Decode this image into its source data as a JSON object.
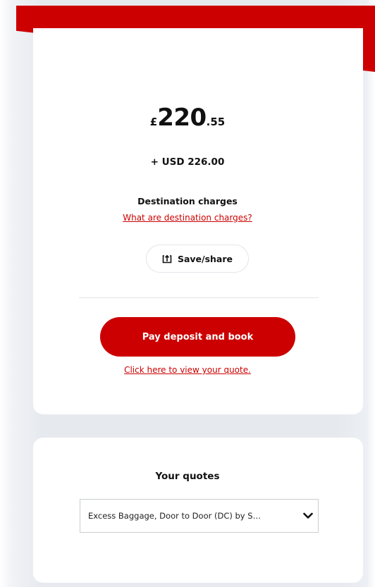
{
  "price": {
    "currency_symbol": "£",
    "whole": "220",
    "decimal": ".55",
    "additional": "+ USD 226.00"
  },
  "destination": {
    "title": "Destination charges",
    "link": "What are destination charges?"
  },
  "share_button": {
    "label": "Save/share",
    "icon": "share-upload-icon"
  },
  "pay_button": {
    "label": "Pay deposit and book"
  },
  "quote_link": {
    "label": "Click here to view your quote."
  },
  "quotes": {
    "title": "Your quotes",
    "selected": "Excess Baggage, Door to Door (DC) by S…",
    "icon": "chevron-down-icon"
  },
  "colors": {
    "brand_red": "#cc0000",
    "card_bg": "#ffffff",
    "page_bg": "#e6e9ee"
  }
}
